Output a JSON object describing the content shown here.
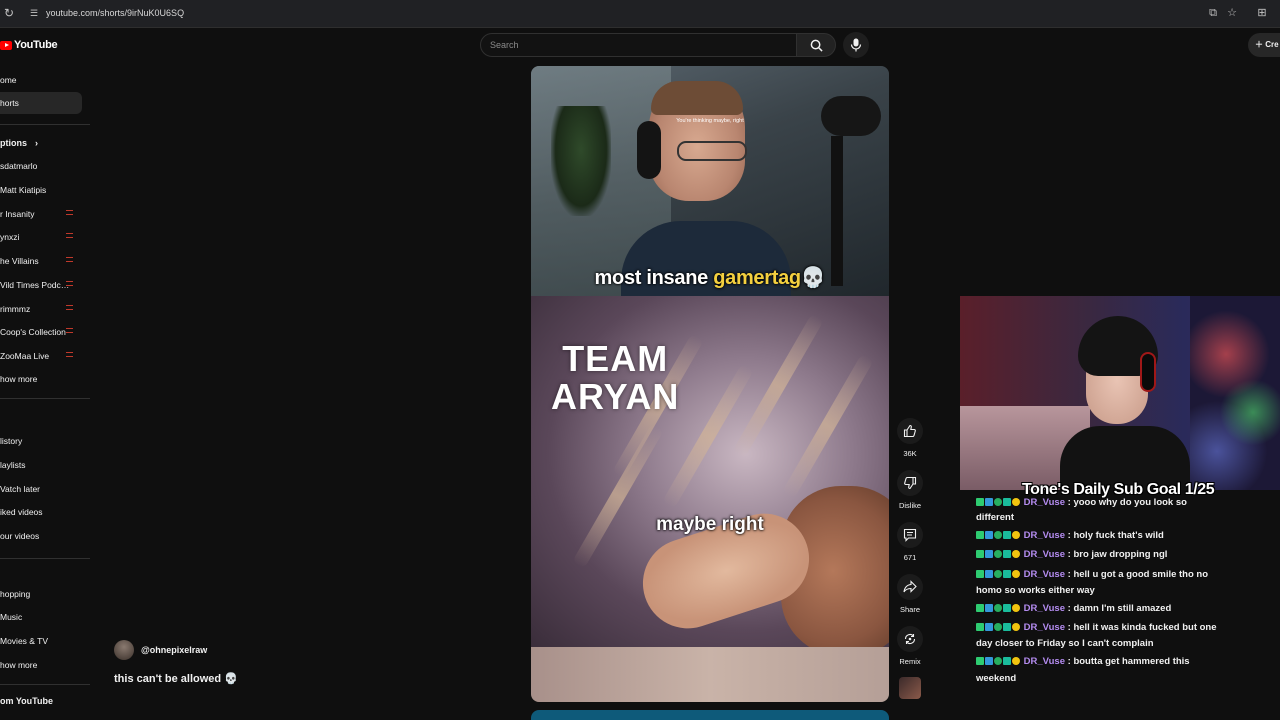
{
  "browser": {
    "url": "youtube.com/shorts/9irNuK0U6SQ"
  },
  "header": {
    "logo_text": "YouTube",
    "search_placeholder": "Search",
    "create_label": "Cre"
  },
  "sidebar": {
    "main": [
      {
        "label": "ome"
      },
      {
        "label": "horts",
        "active": true
      }
    ],
    "subscriptions_heading": "ptions",
    "subscriptions": [
      {
        "label": "sdatmarlo",
        "live": false
      },
      {
        "label": "Matt Kiatipis",
        "live": false
      },
      {
        "label": "r Insanity",
        "live": true
      },
      {
        "label": "ynxzi",
        "live": true
      },
      {
        "label": "he Villains",
        "live": true
      },
      {
        "label": "Vild Times Podc…",
        "live": true
      },
      {
        "label": "rimmmz",
        "live": true
      },
      {
        "label": "Coop's Collection",
        "live": true
      },
      {
        "label": "ZooMaa Live",
        "live": true
      }
    ],
    "subs_show_more": "how more",
    "you": [
      {
        "label": "listory"
      },
      {
        "label": "laylists"
      },
      {
        "label": "Vatch later"
      },
      {
        "label": "iked videos"
      },
      {
        "label": "our videos"
      }
    ],
    "explore": [
      {
        "label": "hopping"
      },
      {
        "label": "Music"
      },
      {
        "label": "Movies & TV"
      }
    ],
    "explore_show_more": "how more",
    "more_from": "om YouTube"
  },
  "short": {
    "top_subtitle": "You're thinking maybe, right",
    "caption_part1": "most insane ",
    "caption_highlight": "gamertag",
    "caption_emoji": "💀",
    "team_line1": "TEAM",
    "team_line2": "ARYAN",
    "caption_bottom": "maybe right",
    "channel": "@ohnepixelraw",
    "title": "this can't be allowed 💀"
  },
  "actions": {
    "like_count": "36K",
    "dislike_label": "Dislike",
    "comments_count": "671",
    "share_label": "Share",
    "remix_label": "Remix"
  },
  "stream": {
    "goal_text": "Tone's Daily Sub Goal 1/25",
    "chat": [
      {
        "user": "DR_Vuse",
        "msg": "yooo why do you look so"
      },
      {
        "user": "",
        "msg": "different"
      },
      {
        "user": "DR_Vuse",
        "msg": "holy fuck that's wild"
      },
      {
        "user": "DR_Vuse",
        "msg": "bro jaw dropping ngl"
      },
      {
        "user": "DR_Vuse",
        "msg": "hell u got a good smile tho no"
      },
      {
        "user": "",
        "msg": "homo so works either way"
      },
      {
        "user": "DR_Vuse",
        "msg": "damn I'm still amazed"
      },
      {
        "user": "DR_Vuse",
        "msg": "hell it was kinda fucked but one"
      },
      {
        "user": "",
        "msg": "day closer to Friday so I can't complain"
      },
      {
        "user": "DR_Vuse",
        "msg": "boutta get hammered this"
      },
      {
        "user": "",
        "msg": "weekend"
      }
    ],
    "user_color": "#b48cf0"
  }
}
